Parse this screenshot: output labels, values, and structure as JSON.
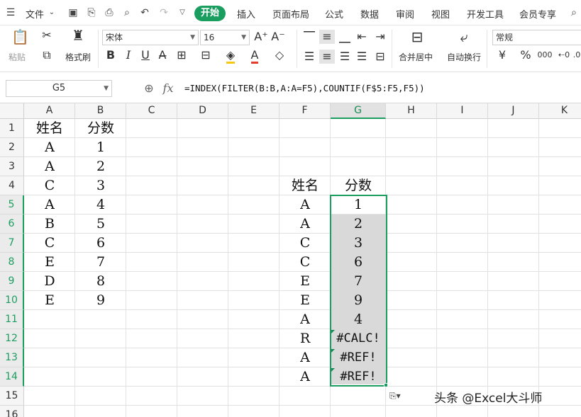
{
  "menubar": {
    "file_label": "文件",
    "tabs": [
      "开始",
      "插入",
      "页面布局",
      "公式",
      "数据",
      "审阅",
      "视图",
      "开发工具",
      "会员专享"
    ]
  },
  "ribbon": {
    "paste_label": "粘贴",
    "format_painter_label": "格式刷",
    "font_name": "宋体",
    "font_size": "16",
    "merge_label": "合并居中",
    "wrap_label": "自动换行",
    "number_format": "常规",
    "currency_symbol": "¥",
    "percent_symbol": "%",
    "thousands_symbol": "000"
  },
  "formula_bar": {
    "name_box": "G5",
    "fx_label": "fx",
    "formula": "=INDEX(FILTER(B:B,A:A=F5),COUNTIF(F$5:F5,F5))"
  },
  "sheet": {
    "columns": [
      "A",
      "B",
      "C",
      "D",
      "E",
      "F",
      "G",
      "H",
      "I",
      "J",
      "K"
    ],
    "rows": [
      "1",
      "2",
      "3",
      "4",
      "5",
      "6",
      "7",
      "8",
      "9",
      "10",
      "11",
      "12",
      "13",
      "14",
      "15",
      "16"
    ],
    "selected_column": "G",
    "selected_rows": [
      "5",
      "6",
      "7",
      "8",
      "9",
      "10",
      "11",
      "12",
      "13",
      "14"
    ],
    "colA": [
      "姓名",
      "A",
      "A",
      "C",
      "A",
      "B",
      "C",
      "E",
      "D",
      "E"
    ],
    "colB": [
      "分数",
      "1",
      "2",
      "3",
      "4",
      "5",
      "6",
      "7",
      "8",
      "9"
    ],
    "colF": [
      "姓名",
      "A",
      "A",
      "C",
      "C",
      "E",
      "E",
      "A",
      "R",
      "A",
      "A"
    ],
    "colG": [
      "分数",
      "1",
      "2",
      "3",
      "6",
      "7",
      "9",
      "4",
      "#CALC!",
      "#REF!",
      "#REF!"
    ]
  },
  "watermark": "头条 @Excel大斗师",
  "colors": {
    "accent": "#1a9e5f",
    "selection_fill": "#d9d9d9"
  }
}
